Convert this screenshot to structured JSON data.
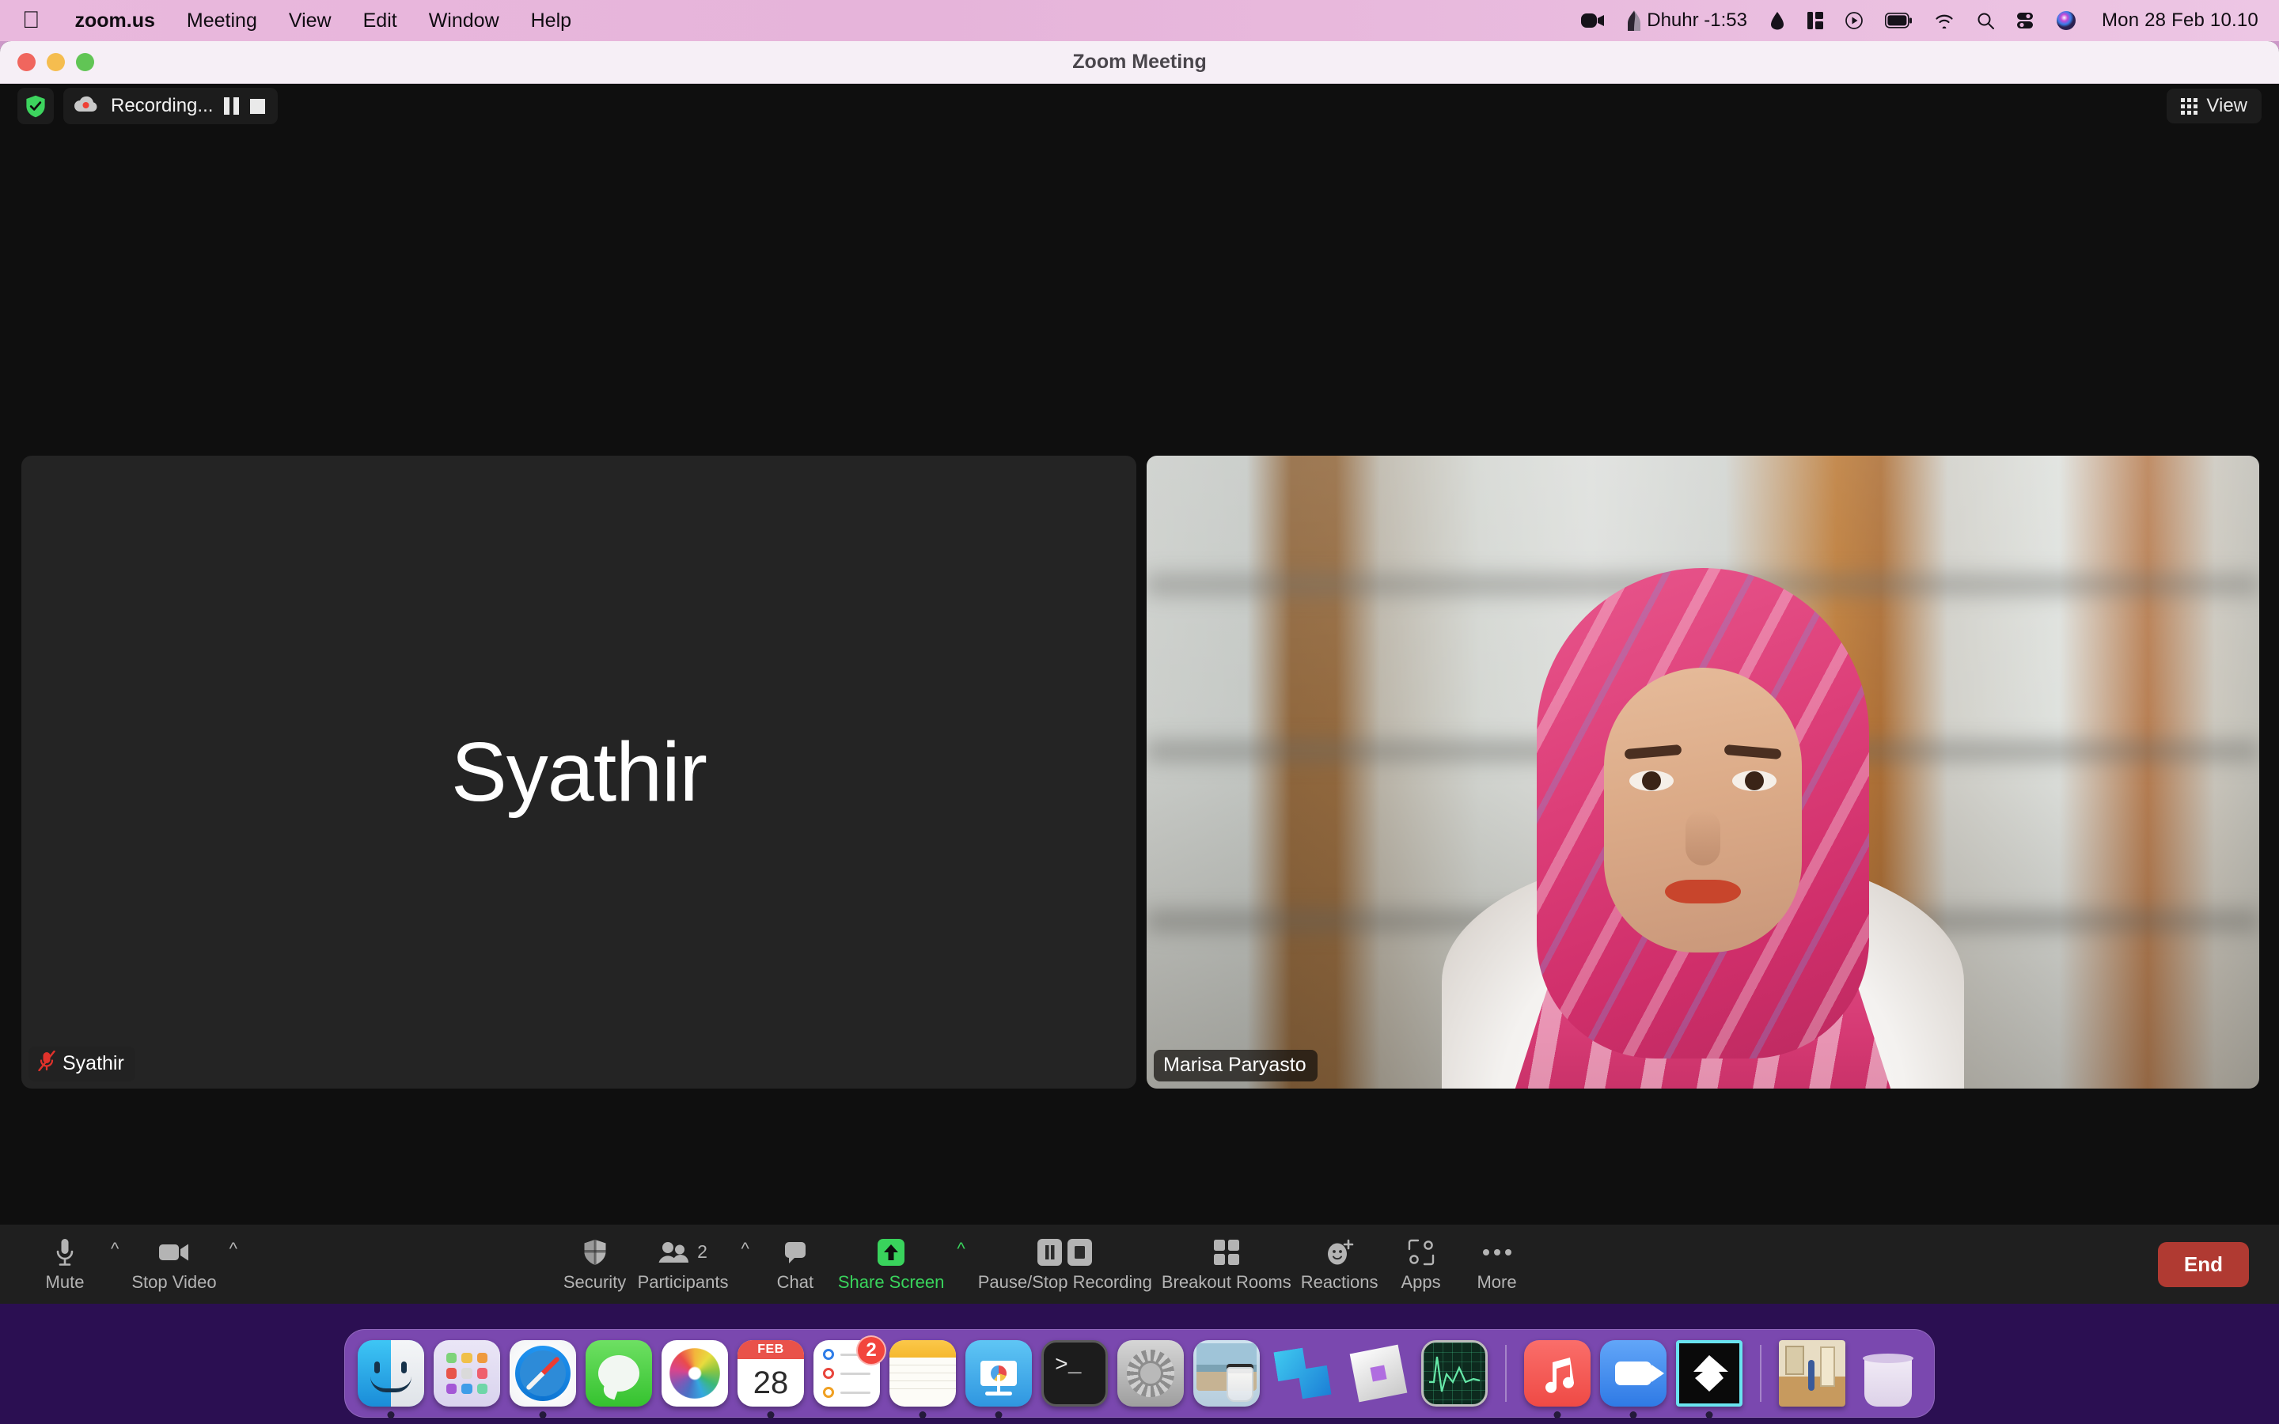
{
  "menubar": {
    "apple_glyph": "",
    "items": [
      {
        "label": "zoom.us",
        "bold": true
      },
      {
        "label": "Meeting",
        "bold": false
      },
      {
        "label": "View",
        "bold": false
      },
      {
        "label": "Edit",
        "bold": false
      },
      {
        "label": "Window",
        "bold": false
      },
      {
        "label": "Help",
        "bold": false
      }
    ],
    "status": {
      "camera_icon": "camera-icon",
      "prayer_label": "Dhuhr -1:53",
      "prayer_icon": "mosque-icon",
      "bell_icon": "bell-icon",
      "stage_manager_icon": "stage-manager-icon",
      "play_icon": "play-circle-icon",
      "battery_icon": "battery-icon",
      "wifi_icon": "wifi-icon",
      "search_icon": "search-icon",
      "control_center_icon": "control-center-icon",
      "siri_icon": "siri-icon",
      "clock": "Mon 28 Feb  10.10"
    }
  },
  "window": {
    "title": "Zoom Meeting",
    "traffic_lights": [
      "close",
      "minimize",
      "zoom"
    ]
  },
  "meeting": {
    "topbar": {
      "encryption_icon": "shield-check-icon",
      "cloud_icon": "cloud-record-icon",
      "recording_label": "Recording...",
      "pause_recording_icon": "pause-icon",
      "stop_recording_icon": "stop-icon",
      "view_label": "View",
      "view_icon": "grid-icon"
    },
    "tiles": [
      {
        "id": "syathir",
        "display_name": "Syathir",
        "name_badge": "Syathir",
        "video_on": false,
        "muted": true,
        "mute_icon": "mic-muted-icon"
      },
      {
        "id": "marisa",
        "display_name": "Marisa Paryasto",
        "name_badge": "Marisa Paryasto",
        "video_on": true,
        "muted": false
      }
    ]
  },
  "toolbar": {
    "left": [
      {
        "label": "Mute",
        "icon": "microphone-icon",
        "caret": true,
        "active": false
      },
      {
        "label": "Stop Video",
        "icon": "video-camera-icon",
        "caret": true,
        "active": false
      }
    ],
    "center": [
      {
        "label": "Security",
        "icon": "shield-icon",
        "caret": false,
        "active": false
      },
      {
        "label": "Participants",
        "icon": "participants-icon",
        "caret": true,
        "active": false,
        "count": "2"
      },
      {
        "label": "Chat",
        "icon": "chat-bubble-icon",
        "caret": false,
        "active": false
      },
      {
        "label": "Share Screen",
        "icon": "share-screen-icon",
        "caret": true,
        "active": true
      },
      {
        "label": "Pause/Stop Recording",
        "icon": "pause-stop-recording-icon",
        "caret": false,
        "active": false
      },
      {
        "label": "Breakout Rooms",
        "icon": "breakout-rooms-icon",
        "caret": false,
        "active": false
      },
      {
        "label": "Reactions",
        "icon": "reactions-icon",
        "caret": false,
        "active": false
      },
      {
        "label": "Apps",
        "icon": "apps-icon",
        "caret": false,
        "active": false
      },
      {
        "label": "More",
        "icon": "more-ellipsis-icon",
        "caret": false,
        "active": false
      }
    ],
    "end_label": "End",
    "end_color": "#b03a32",
    "active_color": "#39d35c"
  },
  "dock": {
    "items": [
      {
        "name": "Finder",
        "icon": "finder-icon",
        "running": true
      },
      {
        "name": "Launchpad",
        "icon": "launchpad-icon",
        "running": false
      },
      {
        "name": "Safari",
        "icon": "safari-icon",
        "running": true
      },
      {
        "name": "Messages",
        "icon": "messages-icon",
        "running": false
      },
      {
        "name": "Photos",
        "icon": "photos-icon",
        "running": false
      },
      {
        "name": "Calendar",
        "icon": "calendar-icon",
        "running": true,
        "month": "FEB",
        "day": "28"
      },
      {
        "name": "Reminders",
        "icon": "reminders-icon",
        "running": false,
        "badge": "2"
      },
      {
        "name": "Notes",
        "icon": "notes-icon",
        "running": true
      },
      {
        "name": "Keynote",
        "icon": "keynote-icon",
        "running": true
      },
      {
        "name": "Terminal",
        "icon": "terminal-icon",
        "running": false,
        "glyph": ">_"
      },
      {
        "name": "System Preferences",
        "icon": "system-preferences-icon",
        "running": false
      },
      {
        "name": "Preview",
        "icon": "preview-icon",
        "running": false
      },
      {
        "name": "Roblox Studio",
        "icon": "roblox-studio-icon",
        "running": false
      },
      {
        "name": "Roblox",
        "icon": "roblox-icon",
        "running": false
      },
      {
        "name": "Activity Monitor",
        "icon": "activity-monitor-icon",
        "running": false
      },
      {
        "name": "separator",
        "icon": "dock-separator",
        "running": false
      },
      {
        "name": "Music",
        "icon": "music-icon",
        "running": true
      },
      {
        "name": "Zoom",
        "icon": "zoom-icon",
        "running": true
      },
      {
        "name": "GameMaker",
        "icon": "gamemaker-icon",
        "running": true,
        "highlighted": true
      },
      {
        "name": "separator2",
        "icon": "dock-separator",
        "running": false
      },
      {
        "name": "Minimized Window",
        "icon": "minimized-window-icon",
        "running": false
      },
      {
        "name": "Trash",
        "icon": "trash-icon",
        "running": false
      }
    ]
  }
}
